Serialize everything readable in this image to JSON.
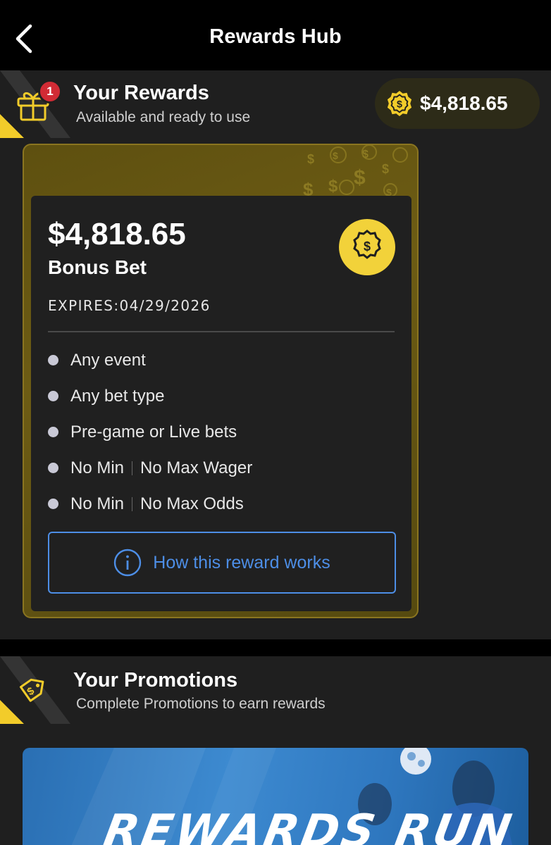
{
  "header": {
    "title": "Rewards Hub"
  },
  "rewards": {
    "title": "Your Rewards",
    "subtitle": "Available and ready to use",
    "badge_count": "1",
    "balance": "$4,818.65",
    "card": {
      "amount": "$4,818.65",
      "type": "Bonus Bet",
      "expires": "EXPIRES:04/29/2026",
      "terms": [
        "Any event",
        "Any bet type",
        "Pre-game or Live bets"
      ],
      "split_terms": [
        {
          "left": "No Min",
          "right": "No Max Wager"
        },
        {
          "left": "No Min",
          "right": "No Max Odds"
        }
      ],
      "info_button": "How this reward works"
    }
  },
  "promotions": {
    "title": "Your Promotions",
    "subtitle": "Complete Promotions to earn rewards",
    "banner_text": "REWARDS RUN"
  },
  "colors": {
    "accent_gold": "#f2cc2a",
    "link_blue": "#4d8ee6",
    "badge_red": "#d12b35"
  }
}
